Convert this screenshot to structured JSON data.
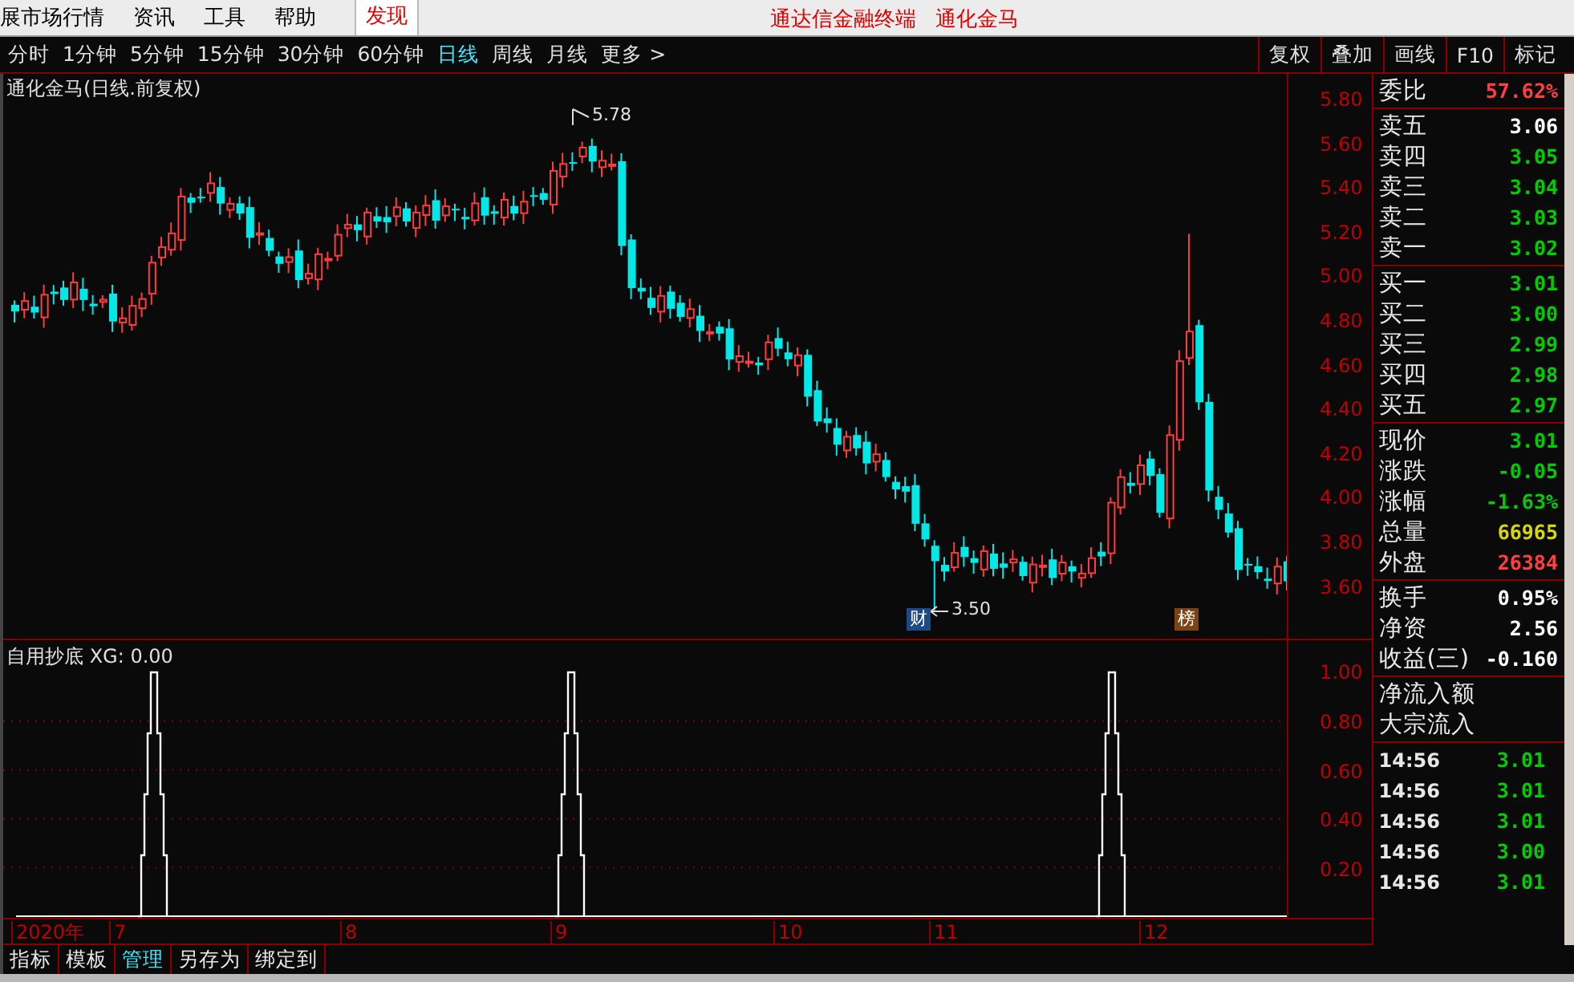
{
  "menu": [
    {
      "label": "展市场行情",
      "selected": false
    },
    {
      "label": "资讯",
      "selected": false
    },
    {
      "label": "工具",
      "selected": false
    },
    {
      "label": "帮助",
      "selected": false
    },
    {
      "label": "发现",
      "selected": true
    }
  ],
  "app_title": "通达信金融终端",
  "stock_title": "通化金马",
  "periods": [
    {
      "label": "分时",
      "selected": false
    },
    {
      "label": "1分钟",
      "selected": false
    },
    {
      "label": "5分钟",
      "selected": false
    },
    {
      "label": "15分钟",
      "selected": false
    },
    {
      "label": "30分钟",
      "selected": false
    },
    {
      "label": "60分钟",
      "selected": false
    },
    {
      "label": "日线",
      "selected": true
    },
    {
      "label": "周线",
      "selected": false
    },
    {
      "label": "月线",
      "selected": false
    },
    {
      "label": "更多 >",
      "selected": false
    }
  ],
  "tools": [
    "复权",
    "叠加",
    "画线",
    "F10",
    "标记"
  ],
  "chart": {
    "title": "通化金马(日线.前复权)",
    "price_labels": [
      "5.80",
      "5.60",
      "5.40",
      "5.20",
      "5.00",
      "4.80",
      "4.60",
      "4.40",
      "4.20",
      "4.00",
      "3.80",
      "3.60"
    ],
    "high_label": "5.78",
    "low_label": "3.50",
    "badges": [
      {
        "text": "财",
        "color": "#1c4a86"
      },
      {
        "text": "榜",
        "color": "#7a4512"
      }
    ]
  },
  "indicator": {
    "title": "自用抄底 XG: 0.00",
    "labels": [
      "1.00",
      "0.80",
      "0.60",
      "0.40",
      "0.20"
    ]
  },
  "date_axis": [
    "2020年",
    "7",
    "8",
    "9",
    "10",
    "11",
    "12"
  ],
  "bottom_tabs": [
    {
      "label": "指标",
      "selected": false
    },
    {
      "label": "模板",
      "selected": false
    },
    {
      "label": "管理",
      "selected": true
    },
    {
      "label": "另存为",
      "selected": false
    },
    {
      "label": "绑定到",
      "selected": false
    }
  ],
  "quote": {
    "groups": [
      [
        {
          "label": "委比",
          "value": "57.62%",
          "color": "#ff4040"
        }
      ],
      [
        {
          "label": "卖五",
          "value": "3.06",
          "color": "#ffffff"
        },
        {
          "label": "卖四",
          "value": "3.05",
          "color": "#00cc00"
        },
        {
          "label": "卖三",
          "value": "3.04",
          "color": "#00cc00"
        },
        {
          "label": "卖二",
          "value": "3.03",
          "color": "#00cc00"
        },
        {
          "label": "卖一",
          "value": "3.02",
          "color": "#00cc00"
        }
      ],
      [
        {
          "label": "买一",
          "value": "3.01",
          "color": "#00cc00"
        },
        {
          "label": "买二",
          "value": "3.00",
          "color": "#00cc00"
        },
        {
          "label": "买三",
          "value": "2.99",
          "color": "#00cc00"
        },
        {
          "label": "买四",
          "value": "2.98",
          "color": "#00cc00"
        },
        {
          "label": "买五",
          "value": "2.97",
          "color": "#00cc00"
        }
      ],
      [
        {
          "label": "现价",
          "value": "3.01",
          "color": "#00cc00"
        },
        {
          "label": "涨跌",
          "value": "-0.05",
          "color": "#00cc00"
        },
        {
          "label": "涨幅",
          "value": "-1.63%",
          "color": "#00cc00"
        },
        {
          "label": "总量",
          "value": "66965",
          "color": "#d8d800"
        },
        {
          "label": "外盘",
          "value": "26384",
          "color": "#ff4040"
        }
      ],
      [
        {
          "label": "换手",
          "value": "0.95%",
          "color": "#ffffff"
        },
        {
          "label": "净资",
          "value": "2.56",
          "color": "#ffffff"
        },
        {
          "label": "收益(三)",
          "value": "-0.160",
          "color": "#ffffff"
        }
      ]
    ],
    "flow": [
      "净流入额",
      "大宗流入"
    ],
    "ticks": [
      {
        "time": "14:56",
        "price": "3.01",
        "color": "#00cc00"
      },
      {
        "time": "14:56",
        "price": "3.01",
        "color": "#00cc00"
      },
      {
        "time": "14:56",
        "price": "3.01",
        "color": "#00cc00"
      },
      {
        "time": "14:56",
        "price": "3.00",
        "color": "#00cc00"
      },
      {
        "time": "14:56",
        "price": "3.01",
        "color": "#00cc00"
      }
    ]
  }
}
